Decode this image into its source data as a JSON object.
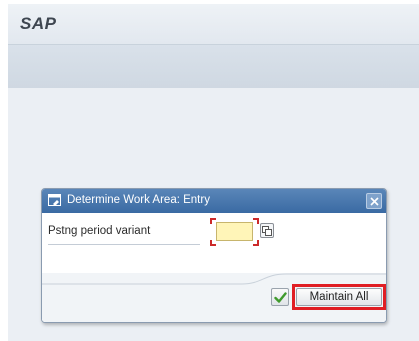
{
  "header": {
    "app_title": "SAP"
  },
  "dialog": {
    "title": "Determine Work Area: Entry",
    "field": {
      "label": "Pstng period variant",
      "value": ""
    },
    "buttons": {
      "maintain_all_label": "Maintain All"
    }
  },
  "icons": {
    "dialog": "window-edit-icon",
    "close": "close-icon",
    "value_help": "value-help-icon",
    "confirm": "checkmark-icon",
    "cancel": "cancel-x-icon"
  },
  "colors": {
    "dialog_header": "#3a6aa3",
    "required_field": "#fff5b8",
    "highlight": "#e01e24",
    "confirm": "#3f9a2c",
    "cancel": "#d8402a"
  }
}
